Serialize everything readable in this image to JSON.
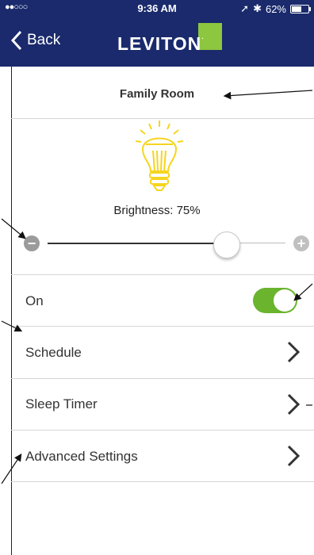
{
  "status_bar": {
    "signal": "●●○○○",
    "time": "9:36 AM",
    "battery_text": "62%",
    "battery_level": 0.62
  },
  "nav": {
    "back_label": "Back",
    "logo_text": "LEVITON",
    "logo_reg": ".",
    "accent": "#8dc63f",
    "background": "#1a2a6c"
  },
  "device": {
    "name": "Family Room",
    "brightness_label": "Brightness: 75%",
    "brightness_value": 75
  },
  "slider": {
    "value": 0.75,
    "minus_symbol": "−",
    "plus_symbol": "+"
  },
  "rows": {
    "on_label": "On",
    "on_state": true,
    "schedule_label": "Schedule",
    "sleep_timer_label": "Sleep Timer",
    "advanced_label": "Advanced Settings"
  },
  "colors": {
    "toggle_on": "#6ab42e",
    "bulb": "#f6d51e"
  }
}
